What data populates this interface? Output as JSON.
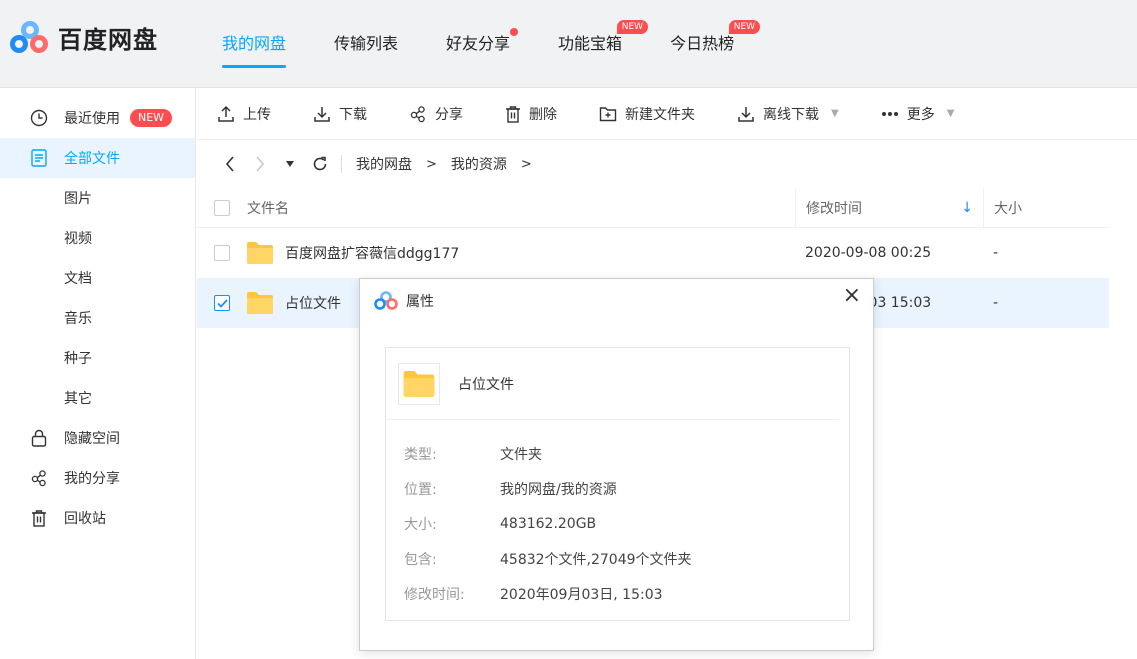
{
  "brand": {
    "name": "百度网盘"
  },
  "nav": {
    "tabs": [
      {
        "label": "我的网盘",
        "active": true
      },
      {
        "label": "传输列表"
      },
      {
        "label": "好友分享",
        "dot": true
      },
      {
        "label": "功能宝箱",
        "badge": "NEW"
      },
      {
        "label": "今日热榜",
        "badge": "NEW"
      }
    ]
  },
  "sidebar": {
    "items": [
      {
        "label": "最近使用",
        "icon": "clock-icon",
        "badge": "NEW"
      },
      {
        "label": "全部文件",
        "icon": "document-icon",
        "active": true
      },
      {
        "label": "图片",
        "sub": true
      },
      {
        "label": "视频",
        "sub": true
      },
      {
        "label": "文档",
        "sub": true
      },
      {
        "label": "音乐",
        "sub": true
      },
      {
        "label": "种子",
        "sub": true
      },
      {
        "label": "其它",
        "sub": true
      },
      {
        "label": "隐藏空间",
        "icon": "lock-icon"
      },
      {
        "label": "我的分享",
        "icon": "share-icon"
      },
      {
        "label": "回收站",
        "icon": "trash-icon"
      }
    ]
  },
  "toolbar": {
    "upload": "上传",
    "download": "下载",
    "share": "分享",
    "delete": "删除",
    "new_folder": "新建文件夹",
    "offline_download": "离线下载",
    "more": "更多"
  },
  "breadcrumb": {
    "items": [
      "我的网盘",
      "我的资源"
    ],
    "separator": ">"
  },
  "table": {
    "headers": {
      "name": "文件名",
      "modified": "修改时间",
      "size": "大小"
    },
    "rows": [
      {
        "name": "百度网盘扩容薇信ddgg177",
        "modified": "2020-09-08 00:25",
        "size": "-",
        "checked": false
      },
      {
        "name": "占位文件",
        "modified": "2020-09-03 15:03",
        "size": "-",
        "checked": true
      }
    ]
  },
  "dialog": {
    "title": "属性",
    "close": "×",
    "file_name": "占位文件",
    "props": [
      {
        "key": "类型:",
        "value": "文件夹"
      },
      {
        "key": "位置:",
        "value": "我的网盘/我的资源"
      },
      {
        "key": "大小:",
        "value": "483162.20GB"
      },
      {
        "key": "包含:",
        "value": "45832个文件,27049个文件夹"
      },
      {
        "key": "修改时间:",
        "value": "2020年09月03日, 15:03"
      }
    ]
  },
  "colors": {
    "accent": "#06a7ff",
    "selected_bg": "#e9f4ff",
    "badge": "#ff4d4f",
    "folder": "#ffc53d"
  }
}
